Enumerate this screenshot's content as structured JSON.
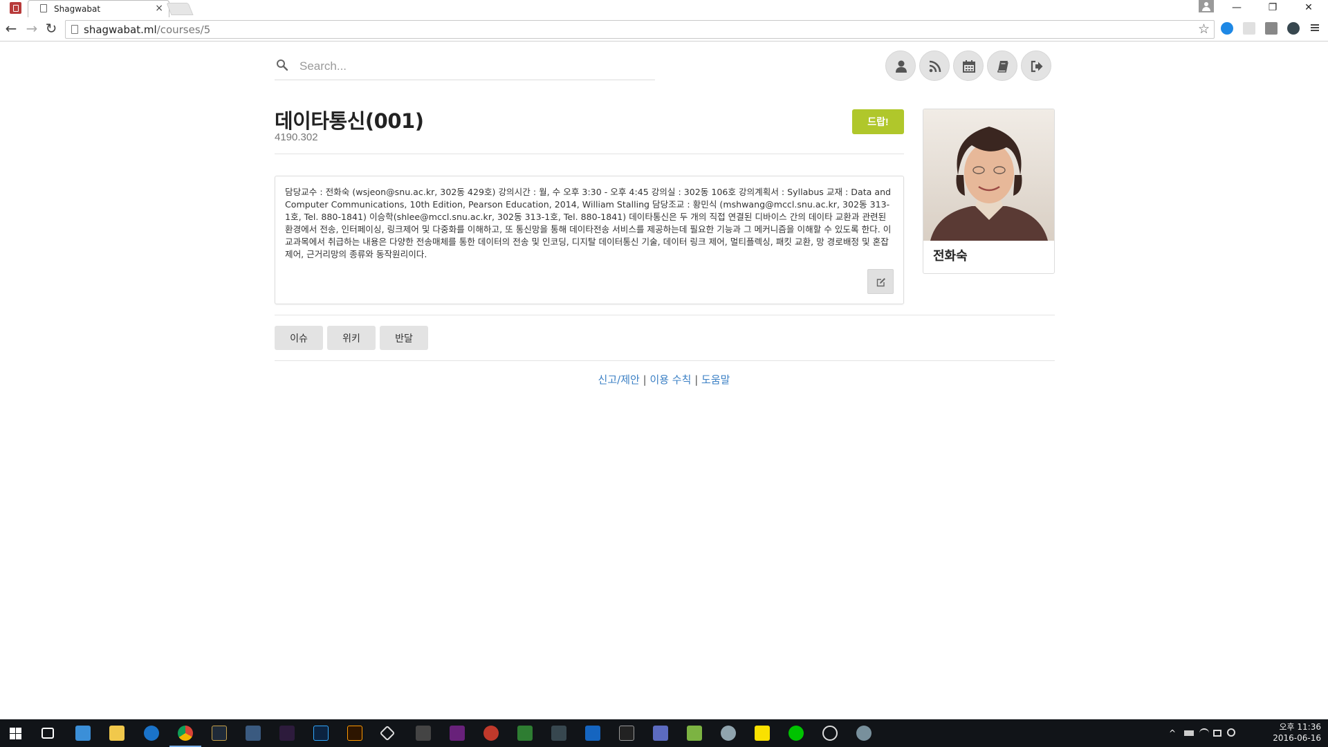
{
  "browser": {
    "tab_title": "Shagwabat",
    "tab_close": "×",
    "url_host": "shagwabat.ml",
    "url_path": "/courses/5",
    "win_minimize": "—",
    "win_restore": "❐",
    "win_close": "✕",
    "back": "←",
    "forward": "→",
    "reload": "↻",
    "bookmark_star": "☆"
  },
  "search": {
    "placeholder": "Search..."
  },
  "header_nav": [
    {
      "icon": "user-icon"
    },
    {
      "icon": "rss-icon"
    },
    {
      "icon": "calendar-icon"
    },
    {
      "icon": "book-icon"
    },
    {
      "icon": "logout-icon"
    }
  ],
  "course": {
    "title": "데이타통신(001)",
    "code": "4190.302",
    "drop_label": "드랍!",
    "description": "담당교수 : 전화숙 (wsjeon@snu.ac.kr, 302동 429호) 강의시간 : 월, 수 오후 3:30 - 오후 4:45 강의실 : 302동 106호 강의계획서 : Syllabus 교재 : Data and Computer Communications, 10th Edition, Pearson Education, 2014, William Stalling 담당조교 : 황민식 (mshwang@mccl.snu.ac.kr, 302동 313-1호, Tel. 880-1841) 이승학(shlee@mccl.snu.ac.kr, 302동 313-1호, Tel. 880-1841) 데이타통신은 두 개의 직접 연결된 디바이스 간의 데이타 교환과 관련된 환경에서 전송, 인터페이싱, 링크제어 및 다중화를 이해하고, 또 통신망을 통해 데이타전송 서비스를 제공하는데 필요한 기능과 그 메커니즘을 이해할 수 있도록 한다. 이 교과목에서 취급하는 내용은 다양한 전송매체를 통한 데이터의 전송 및 인코딩, 디지탈 데이터통신 기술, 데이터 링크 제어, 멀티플렉싱, 패킷 교환, 망 경로배정 및 혼잡제어, 근거리망의 종류와 동작원리이다."
  },
  "professor": {
    "name": "전화숙"
  },
  "tabs": [
    {
      "label": "이슈"
    },
    {
      "label": "위키"
    },
    {
      "label": "반달"
    }
  ],
  "footer": {
    "link1": "신고/제안",
    "sep": "|",
    "link2": "이용 수칙",
    "link3": "도움말"
  },
  "taskbar": {
    "time": "오후 11:36",
    "date": "2016-06-16"
  },
  "colors": {
    "drop_button": "#b0c72b",
    "link": "#3a7fc4",
    "taskbar": "#111418"
  }
}
